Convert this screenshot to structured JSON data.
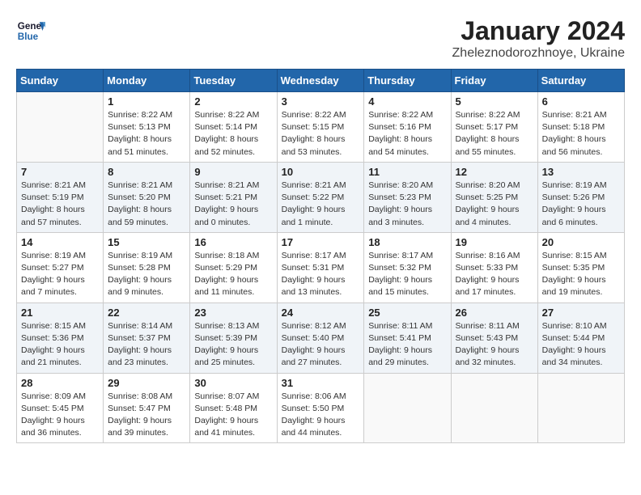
{
  "header": {
    "logo_line1": "General",
    "logo_line2": "Blue",
    "month": "January 2024",
    "location": "Zheleznodorozhnoye, Ukraine"
  },
  "weekdays": [
    "Sunday",
    "Monday",
    "Tuesday",
    "Wednesday",
    "Thursday",
    "Friday",
    "Saturday"
  ],
  "weeks": [
    [
      {
        "day": "",
        "info": ""
      },
      {
        "day": "1",
        "info": "Sunrise: 8:22 AM\nSunset: 5:13 PM\nDaylight: 8 hours\nand 51 minutes."
      },
      {
        "day": "2",
        "info": "Sunrise: 8:22 AM\nSunset: 5:14 PM\nDaylight: 8 hours\nand 52 minutes."
      },
      {
        "day": "3",
        "info": "Sunrise: 8:22 AM\nSunset: 5:15 PM\nDaylight: 8 hours\nand 53 minutes."
      },
      {
        "day": "4",
        "info": "Sunrise: 8:22 AM\nSunset: 5:16 PM\nDaylight: 8 hours\nand 54 minutes."
      },
      {
        "day": "5",
        "info": "Sunrise: 8:22 AM\nSunset: 5:17 PM\nDaylight: 8 hours\nand 55 minutes."
      },
      {
        "day": "6",
        "info": "Sunrise: 8:21 AM\nSunset: 5:18 PM\nDaylight: 8 hours\nand 56 minutes."
      }
    ],
    [
      {
        "day": "7",
        "info": "Sunrise: 8:21 AM\nSunset: 5:19 PM\nDaylight: 8 hours\nand 57 minutes."
      },
      {
        "day": "8",
        "info": "Sunrise: 8:21 AM\nSunset: 5:20 PM\nDaylight: 8 hours\nand 59 minutes."
      },
      {
        "day": "9",
        "info": "Sunrise: 8:21 AM\nSunset: 5:21 PM\nDaylight: 9 hours\nand 0 minutes."
      },
      {
        "day": "10",
        "info": "Sunrise: 8:21 AM\nSunset: 5:22 PM\nDaylight: 9 hours\nand 1 minute."
      },
      {
        "day": "11",
        "info": "Sunrise: 8:20 AM\nSunset: 5:23 PM\nDaylight: 9 hours\nand 3 minutes."
      },
      {
        "day": "12",
        "info": "Sunrise: 8:20 AM\nSunset: 5:25 PM\nDaylight: 9 hours\nand 4 minutes."
      },
      {
        "day": "13",
        "info": "Sunrise: 8:19 AM\nSunset: 5:26 PM\nDaylight: 9 hours\nand 6 minutes."
      }
    ],
    [
      {
        "day": "14",
        "info": "Sunrise: 8:19 AM\nSunset: 5:27 PM\nDaylight: 9 hours\nand 7 minutes."
      },
      {
        "day": "15",
        "info": "Sunrise: 8:19 AM\nSunset: 5:28 PM\nDaylight: 9 hours\nand 9 minutes."
      },
      {
        "day": "16",
        "info": "Sunrise: 8:18 AM\nSunset: 5:29 PM\nDaylight: 9 hours\nand 11 minutes."
      },
      {
        "day": "17",
        "info": "Sunrise: 8:17 AM\nSunset: 5:31 PM\nDaylight: 9 hours\nand 13 minutes."
      },
      {
        "day": "18",
        "info": "Sunrise: 8:17 AM\nSunset: 5:32 PM\nDaylight: 9 hours\nand 15 minutes."
      },
      {
        "day": "19",
        "info": "Sunrise: 8:16 AM\nSunset: 5:33 PM\nDaylight: 9 hours\nand 17 minutes."
      },
      {
        "day": "20",
        "info": "Sunrise: 8:15 AM\nSunset: 5:35 PM\nDaylight: 9 hours\nand 19 minutes."
      }
    ],
    [
      {
        "day": "21",
        "info": "Sunrise: 8:15 AM\nSunset: 5:36 PM\nDaylight: 9 hours\nand 21 minutes."
      },
      {
        "day": "22",
        "info": "Sunrise: 8:14 AM\nSunset: 5:37 PM\nDaylight: 9 hours\nand 23 minutes."
      },
      {
        "day": "23",
        "info": "Sunrise: 8:13 AM\nSunset: 5:39 PM\nDaylight: 9 hours\nand 25 minutes."
      },
      {
        "day": "24",
        "info": "Sunrise: 8:12 AM\nSunset: 5:40 PM\nDaylight: 9 hours\nand 27 minutes."
      },
      {
        "day": "25",
        "info": "Sunrise: 8:11 AM\nSunset: 5:41 PM\nDaylight: 9 hours\nand 29 minutes."
      },
      {
        "day": "26",
        "info": "Sunrise: 8:11 AM\nSunset: 5:43 PM\nDaylight: 9 hours\nand 32 minutes."
      },
      {
        "day": "27",
        "info": "Sunrise: 8:10 AM\nSunset: 5:44 PM\nDaylight: 9 hours\nand 34 minutes."
      }
    ],
    [
      {
        "day": "28",
        "info": "Sunrise: 8:09 AM\nSunset: 5:45 PM\nDaylight: 9 hours\nand 36 minutes."
      },
      {
        "day": "29",
        "info": "Sunrise: 8:08 AM\nSunset: 5:47 PM\nDaylight: 9 hours\nand 39 minutes."
      },
      {
        "day": "30",
        "info": "Sunrise: 8:07 AM\nSunset: 5:48 PM\nDaylight: 9 hours\nand 41 minutes."
      },
      {
        "day": "31",
        "info": "Sunrise: 8:06 AM\nSunset: 5:50 PM\nDaylight: 9 hours\nand 44 minutes."
      },
      {
        "day": "",
        "info": ""
      },
      {
        "day": "",
        "info": ""
      },
      {
        "day": "",
        "info": ""
      }
    ]
  ]
}
